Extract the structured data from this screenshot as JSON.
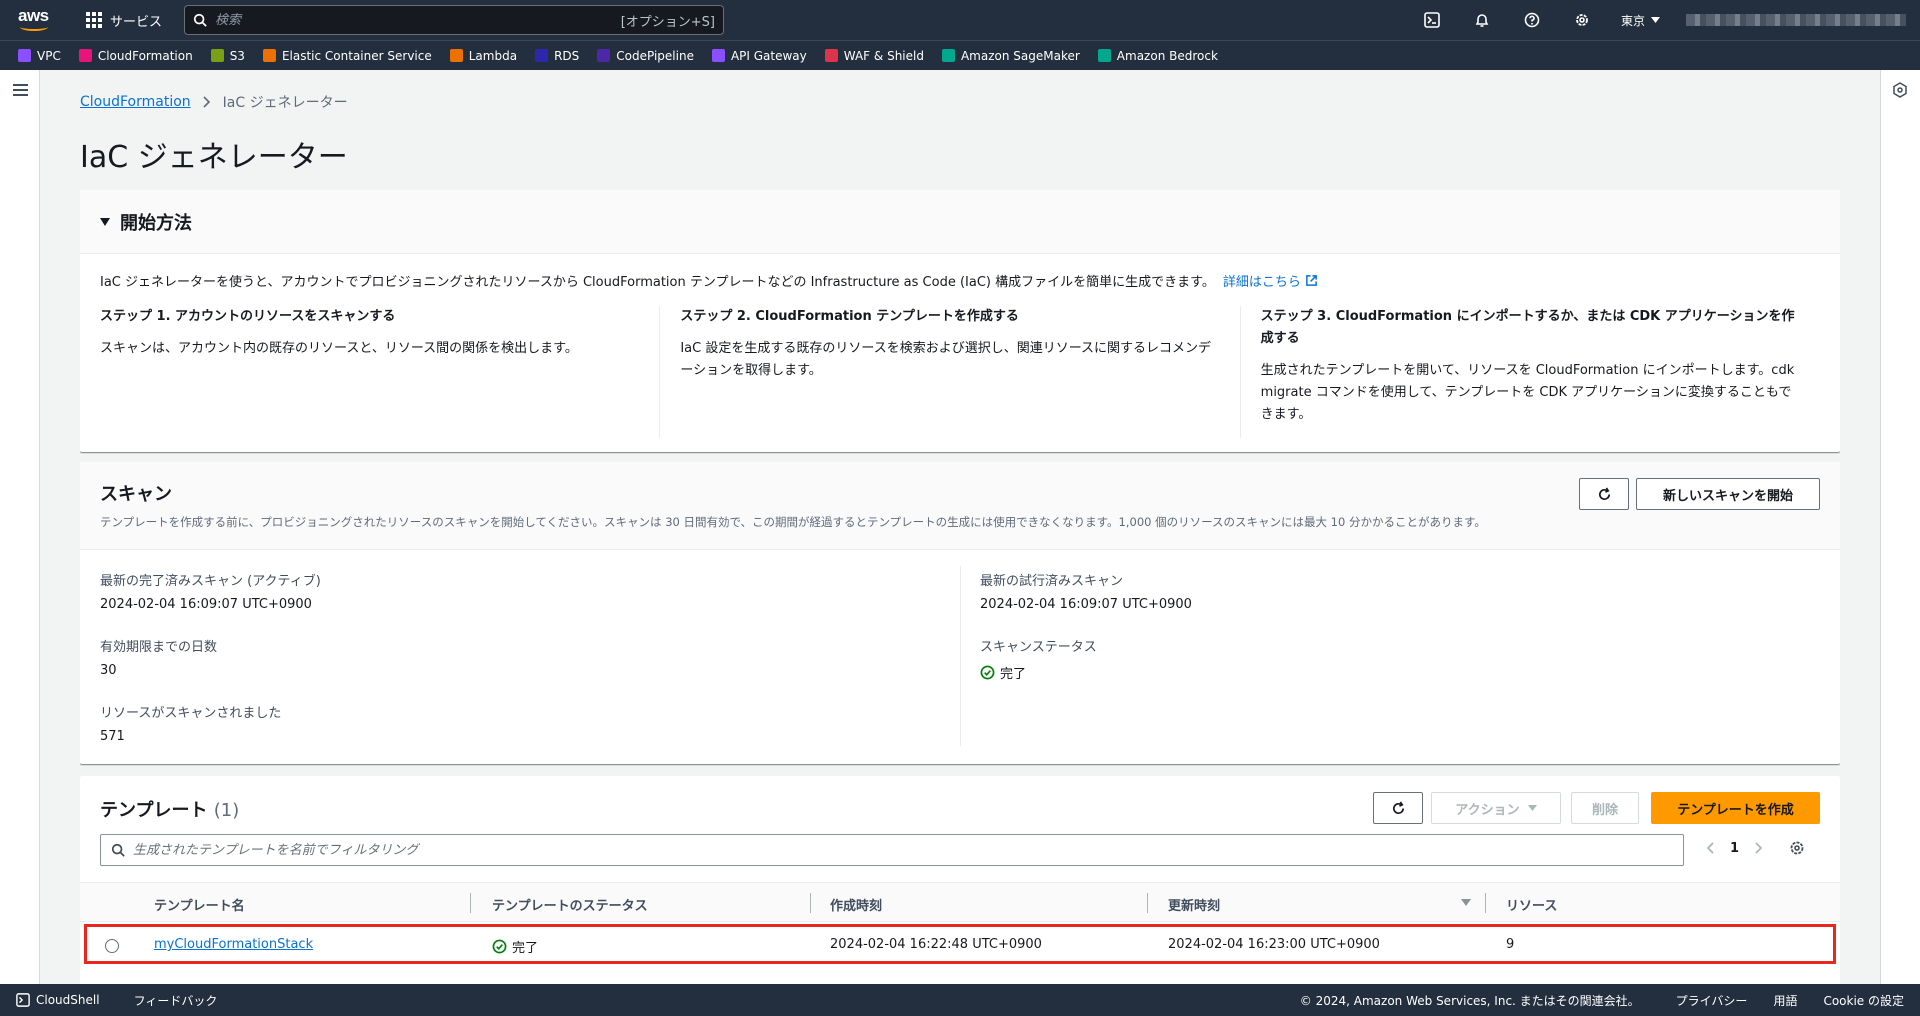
{
  "topnav": {
    "logo_text": "aws",
    "services_label": "サービス",
    "search_placeholder": "検索",
    "search_hint": "[オプション+S]",
    "region": "東京"
  },
  "favorites": [
    {
      "label": "VPC",
      "color": "#8c4fff"
    },
    {
      "label": "CloudFormation",
      "color": "#e7157b"
    },
    {
      "label": "S3",
      "color": "#7aa116"
    },
    {
      "label": "Elastic Container Service",
      "color": "#ed7100"
    },
    {
      "label": "Lambda",
      "color": "#ed7100"
    },
    {
      "label": "RDS",
      "color": "#2e27ad"
    },
    {
      "label": "CodePipeline",
      "color": "#4d27aa"
    },
    {
      "label": "API Gateway",
      "color": "#8c4fff"
    },
    {
      "label": "WAF & Shield",
      "color": "#dd344c"
    },
    {
      "label": "Amazon SageMaker",
      "color": "#01a88d"
    },
    {
      "label": "Amazon Bedrock",
      "color": "#01a88d"
    }
  ],
  "breadcrumb": {
    "parent": "CloudFormation",
    "current": "IaC ジェネレーター"
  },
  "page_title": "IaC ジェネレーター",
  "get_started": {
    "title": "開始方法",
    "intro": "IaC ジェネレーターを使うと、アカウントでプロビジョニングされたリソースから CloudFormation テンプレートなどの Infrastructure as Code (IaC) 構成ファイルを簡単に生成できます。",
    "learn_more": "詳細はこちら",
    "steps": [
      {
        "title": "ステップ 1. アカウントのリソースをスキャンする",
        "body": "スキャンは、アカウント内の既存のリソースと、リソース間の関係を検出します。"
      },
      {
        "title": "ステップ 2. CloudFormation テンプレートを作成する",
        "body": "IaC 設定を生成する既存のリソースを検索および選択し、関連リソースに関するレコメンデーションを取得します。"
      },
      {
        "title": "ステップ 3. CloudFormation にインポートするか、または CDK アプリケーションを作成する",
        "body": "生成されたテンプレートを開いて、リソースを CloudFormation にインポートします。cdk migrate コマンドを使用して、テンプレートを CDK アプリケーションに変換することもできます。"
      }
    ]
  },
  "scan": {
    "title": "スキャン",
    "description": "テンプレートを作成する前に、プロビジョニングされたリソースのスキャンを開始してください。スキャンは 30 日間有効で、この期間が経過するとテンプレートの生成には使用できなくなります。1,000 個のリソースのスキャンには最大 10 分かかることがあります。",
    "start_button": "新しいスキャンを開始",
    "latest_complete_label": "最新の完了済みスキャン (アクティブ)",
    "latest_complete_value": "2024-02-04 16:09:07 UTC+0900",
    "days_label": "有効期限までの日数",
    "days_value": "30",
    "resources_label": "リソースがスキャンされました",
    "resources_value": "571",
    "latest_attempt_label": "最新の試行済みスキャン",
    "latest_attempt_value": "2024-02-04 16:09:07 UTC+0900",
    "status_label": "スキャンステータス",
    "status_value": "完了"
  },
  "templates": {
    "title": "テンプレート",
    "count": "(1)",
    "actions_button": "アクション",
    "delete_button": "削除",
    "create_button": "テンプレートを作成",
    "filter_placeholder": "生成されたテンプレートを名前でフィルタリング",
    "page": "1",
    "columns": [
      "テンプレート名",
      "テンプレートのステータス",
      "作成時刻",
      "更新時刻",
      "リソース"
    ],
    "rows": [
      {
        "name": "myCloudFormationStack",
        "status": "完了",
        "created": "2024-02-04 16:22:48 UTC+0900",
        "updated": "2024-02-04 16:23:00 UTC+0900",
        "resources": "9"
      }
    ]
  },
  "footer": {
    "cloudshell": "CloudShell",
    "feedback": "フィードバック",
    "copyright": "© 2024, Amazon Web Services, Inc. またはその関連会社。",
    "privacy": "プライバシー",
    "terms": "用語",
    "cookie": "Cookie の設定"
  }
}
